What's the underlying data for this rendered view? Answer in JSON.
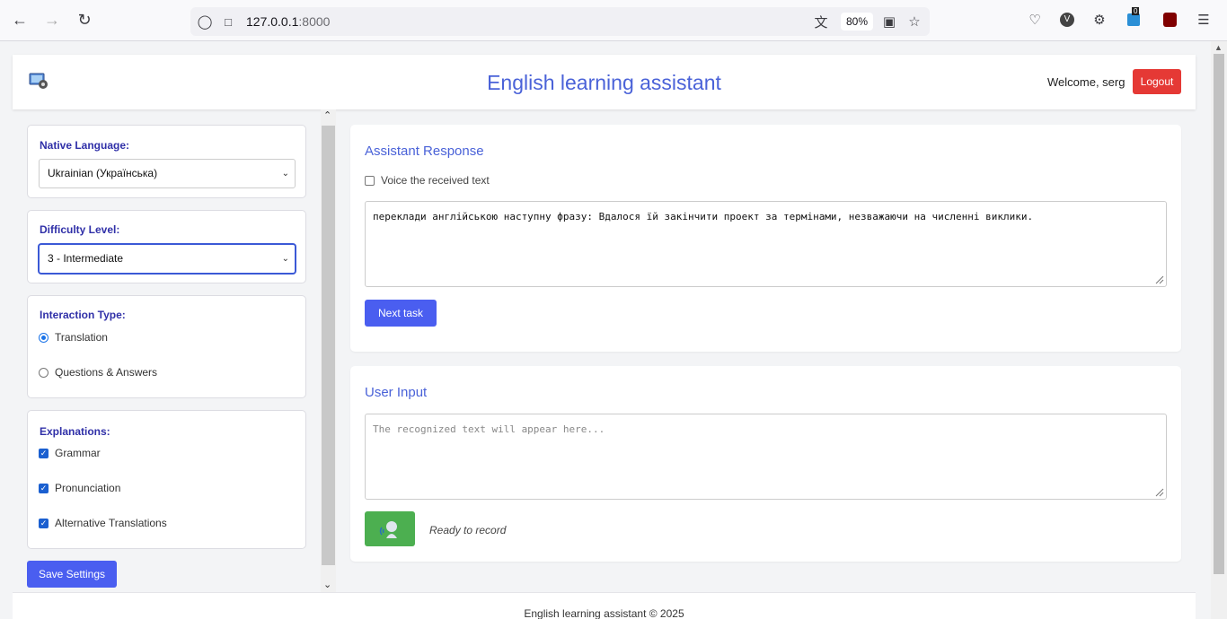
{
  "browser": {
    "url_host": "127.0.0.1",
    "url_port": ":8000",
    "zoom": "80%",
    "notification_count": "0"
  },
  "header": {
    "title": "English learning assistant",
    "welcome": "Welcome, serg",
    "logout_label": "Logout"
  },
  "sidebar": {
    "native_language": {
      "label": "Native Language:",
      "selected": "Ukrainian (Українська)"
    },
    "difficulty": {
      "label": "Difficulty Level:",
      "selected": "3 - Intermediate"
    },
    "interaction_type": {
      "label": "Interaction Type:",
      "options": [
        {
          "label": "Translation",
          "checked": true
        },
        {
          "label": "Questions & Answers",
          "checked": false
        }
      ]
    },
    "explanations": {
      "label": "Explanations:",
      "options": [
        {
          "label": "Grammar",
          "checked": true
        },
        {
          "label": "Pronunciation",
          "checked": true
        },
        {
          "label": "Alternative Translations",
          "checked": true
        }
      ]
    },
    "save_label": "Save Settings"
  },
  "assistant": {
    "title": "Assistant Response",
    "voice_label": "Voice the received text",
    "response_text": "переклади англійською наступну фразу: Вдалося їй закінчити проект за термінами, незважаючи на численні виклики.",
    "next_label": "Next task"
  },
  "user_input": {
    "title": "User Input",
    "placeholder": "The recognized text will appear here...",
    "status": "Ready to record"
  },
  "footer": {
    "text": "English learning assistant © 2025"
  },
  "colors": {
    "accent": "#4a62d8",
    "button": "#4a5ef0",
    "logout": "#e53935",
    "record": "#4caf50"
  }
}
